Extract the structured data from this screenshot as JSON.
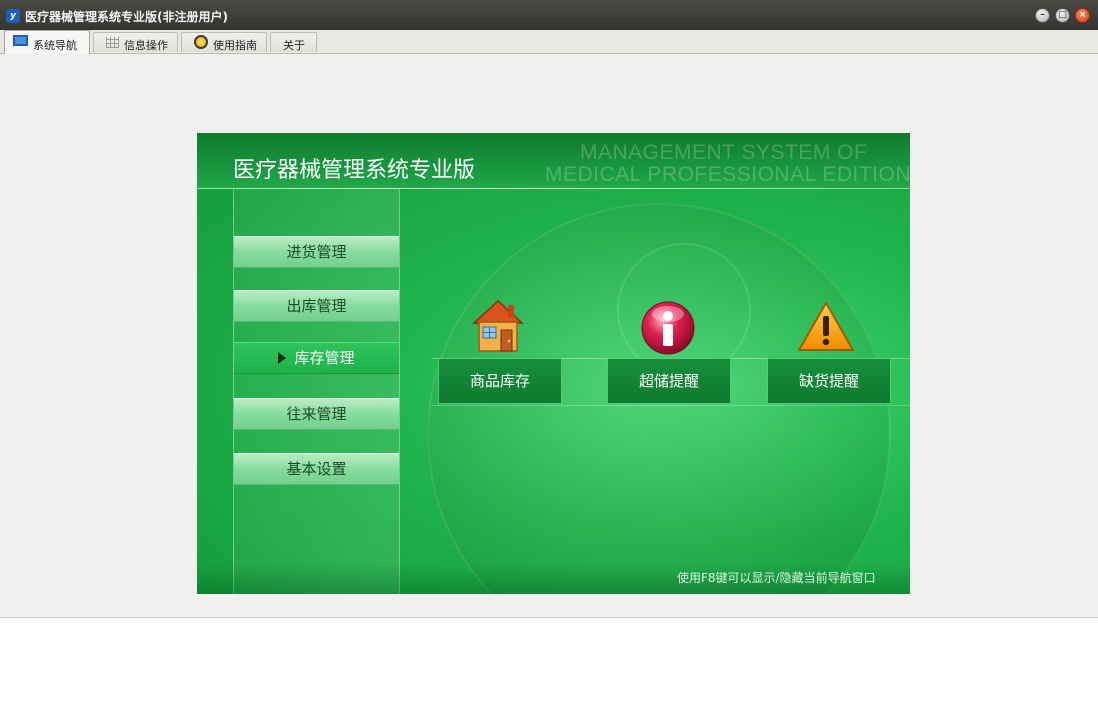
{
  "window": {
    "title": "医疗器械管理系统专业版(非注册用户)",
    "app_icon": "y"
  },
  "tabs": [
    {
      "label": "系统导航",
      "icon": "monitor-icon",
      "active": true
    },
    {
      "label": "信息操作",
      "icon": "grid-icon",
      "active": false
    },
    {
      "label": "使用指南",
      "icon": "guide-icon",
      "active": false
    },
    {
      "label": "关于",
      "icon": "",
      "active": false
    }
  ],
  "panel": {
    "title": "医疗器械管理系统专业版",
    "watermark_line1": "MANAGEMENT SYSTEM OF",
    "watermark_line2": "MEDICAL PROFESSIONAL EDITION",
    "hint": "使用F8键可以显示/隐藏当前导航窗口"
  },
  "menu": {
    "items": [
      {
        "label": "进货管理",
        "selected": false
      },
      {
        "label": "出库管理",
        "selected": false
      },
      {
        "label": "库存管理",
        "selected": true
      },
      {
        "label": "往来管理",
        "selected": false
      },
      {
        "label": "基本设置",
        "selected": false
      }
    ]
  },
  "functions": [
    {
      "label": "商品库存",
      "icon": "house-icon"
    },
    {
      "label": "超储提醒",
      "icon": "info-icon"
    },
    {
      "label": "缺货提醒",
      "icon": "warning-icon"
    }
  ],
  "colors": {
    "panel_green": "#1fae49",
    "header_green": "#0f7a2c",
    "menu_selected": "#2ec45a",
    "titlebar": "#3d3c39"
  }
}
